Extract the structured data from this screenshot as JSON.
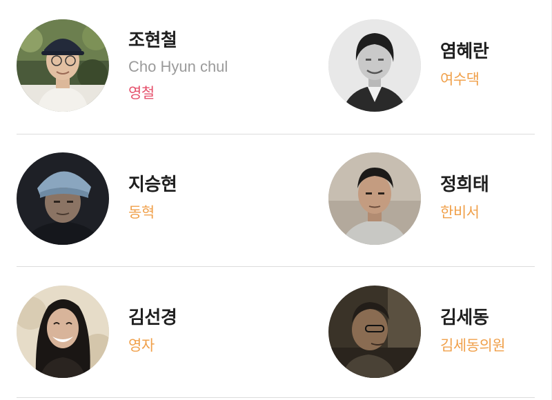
{
  "colors": {
    "role_orange": "#f0a04a",
    "role_pink": "#e5506b",
    "name_text": "#1f1f1f",
    "english_name_text": "#9a9a9a",
    "divider": "#dcdcdc"
  },
  "cast": [
    {
      "name": "조현철",
      "english_name": "Cho Hyun chul",
      "role": "영철",
      "role_color": "#e5506b",
      "photo": "actor-photo-outdoor-cap-glasses"
    },
    {
      "name": "염혜란",
      "role": "여수댁",
      "role_color": "#f0a04a",
      "photo": "actor-photo-black-and-white"
    },
    {
      "name": "지승현",
      "role": "동혁",
      "role_color": "#f0a04a",
      "photo": "actor-photo-headscarf-dark"
    },
    {
      "name": "정희태",
      "role": "한비서",
      "role_color": "#f0a04a",
      "photo": "actor-photo-portrait"
    },
    {
      "name": "김선경",
      "role": "영자",
      "role_color": "#f0a04a",
      "photo": "actor-photo-smiling-long-hair"
    },
    {
      "name": "김세동",
      "role": "김세동의원",
      "role_color": "#f0a04a",
      "photo": "actor-photo-profile-glasses"
    }
  ]
}
